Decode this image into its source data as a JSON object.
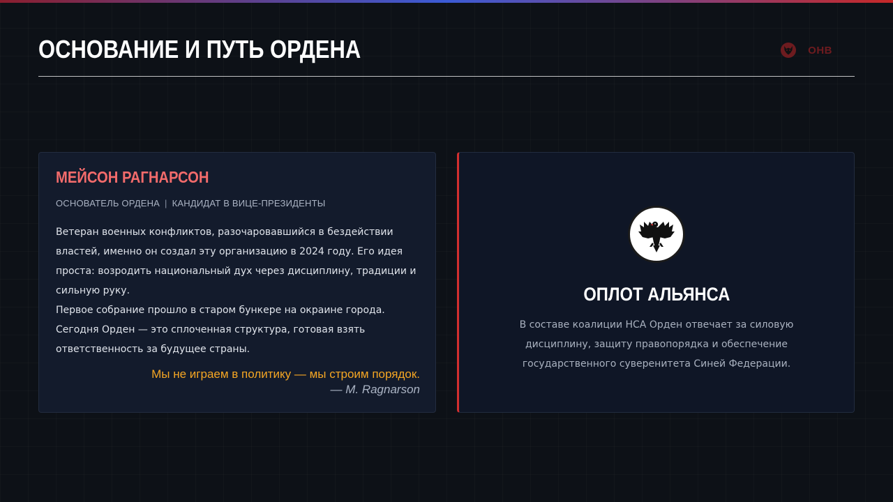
{
  "header": {
    "title": "ОСНОВАНИЕ И ПУТЬ ОРДЕНА",
    "brand_text": "ОНВ",
    "brand_icon": "wolf-head-icon"
  },
  "founder": {
    "name": "МЕЙСОН РАГНАРСОН",
    "role_primary": "ОСНОВАТЕЛЬ ОРДЕНА",
    "role_separator": "|",
    "role_secondary": "КАНДИДАТ В ВИЦЕ-ПРЕЗИДЕНТЫ",
    "bio_paragraph_1": "Ветеран военных конфликтов, разочаровавшийся в бездействии властей, именно он создал эту организацию в 2024 году. Его идея проста: возродить национальный дух через дисциплину, традиции и сильную руку.",
    "bio_paragraph_2": "Первое собрание прошло в старом бункере на окраине города. Сегодня Орден — это сплоченная структура, готовая взять ответственность за будущее страны.",
    "quote": "Мы не играем в политику — мы строим порядок.",
    "quote_author": "— M. Ragnarson"
  },
  "alliance": {
    "emblem_icon": "black-eagle-icon",
    "title": "ОПЛОТ АЛЬЯНСА",
    "description": "В составе коалиции НСА Орден отвечает за силовую дисциплину, защиту правопорядка и обеспечение государственного суверенитета Синей Федерации."
  },
  "colors": {
    "accent_red": "#d32f2f",
    "name_red": "#f26b6b",
    "quote_orange": "#f5a623",
    "background": "#0d1117",
    "card": "#131b2c"
  }
}
